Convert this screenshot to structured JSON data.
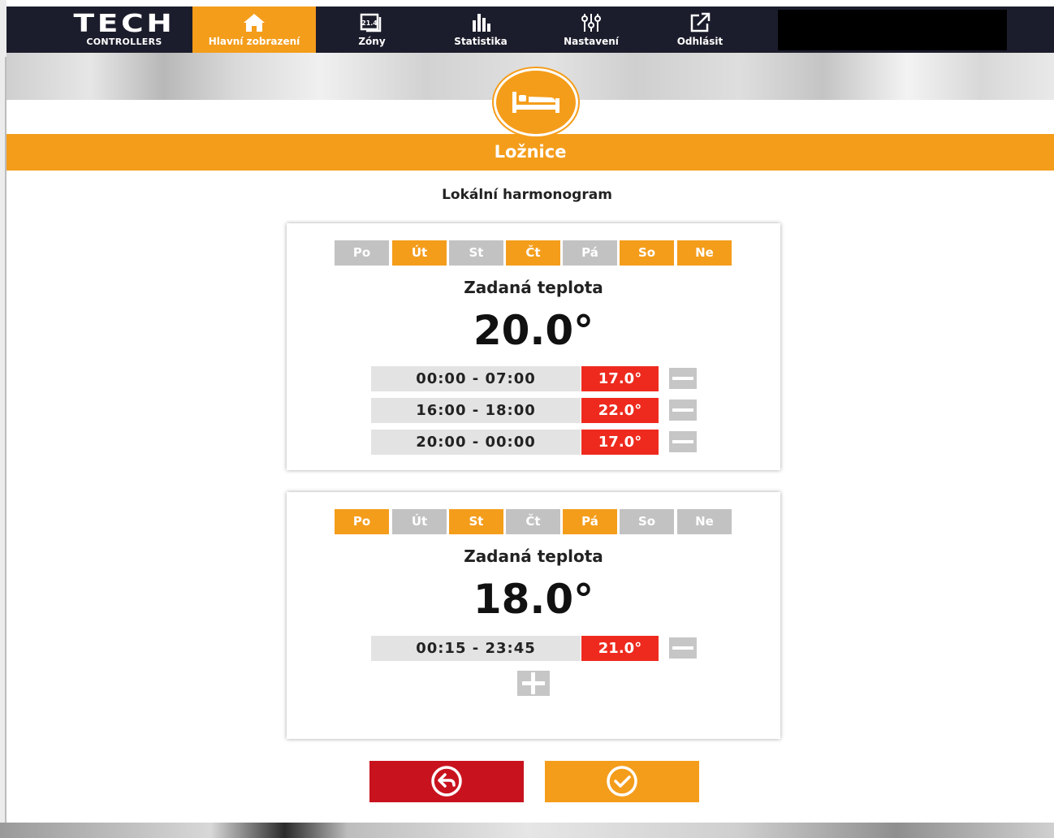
{
  "logo": {
    "brand": "TECH",
    "sub": "CONTROLLERS"
  },
  "nav": [
    {
      "label": "Hlavní zobrazení",
      "icon": "home-icon",
      "active": true
    },
    {
      "label": "Zóny",
      "icon": "zones-icon",
      "badge": "21.4",
      "active": false
    },
    {
      "label": "Statistika",
      "icon": "statistics-icon",
      "active": false
    },
    {
      "label": "Nastavení",
      "icon": "settings-sliders-icon",
      "active": false
    },
    {
      "label": "Odhlásit",
      "icon": "logout-icon",
      "active": false
    }
  ],
  "zone": {
    "name": "Ložnice",
    "icon": "bed-icon"
  },
  "schedule_title": "Lokální harmonogram",
  "cards": [
    {
      "days": [
        {
          "label": "Po",
          "active": false
        },
        {
          "label": "Út",
          "active": true
        },
        {
          "label": "St",
          "active": false
        },
        {
          "label": "Čt",
          "active": true
        },
        {
          "label": "Pá",
          "active": false
        },
        {
          "label": "So",
          "active": true
        },
        {
          "label": "Ne",
          "active": true
        }
      ],
      "setpoint_label": "Zadaná teplota",
      "setpoint": "20.0°",
      "intervals": [
        {
          "time": "00:00 - 07:00",
          "temp": "17.0°"
        },
        {
          "time": "16:00 - 18:00",
          "temp": "22.0°"
        },
        {
          "time": "20:00 - 00:00",
          "temp": "17.0°"
        }
      ]
    },
    {
      "days": [
        {
          "label": "Po",
          "active": true
        },
        {
          "label": "Út",
          "active": false
        },
        {
          "label": "St",
          "active": true
        },
        {
          "label": "Čt",
          "active": false
        },
        {
          "label": "Pá",
          "active": true
        },
        {
          "label": "So",
          "active": false
        },
        {
          "label": "Ne",
          "active": false
        }
      ],
      "setpoint_label": "Zadaná teplota",
      "setpoint": "18.0°",
      "intervals": [
        {
          "time": "00:15 - 23:45",
          "temp": "21.0°"
        }
      ]
    }
  ],
  "buttons": {
    "back_icon": "back-arrow-icon",
    "confirm_icon": "checkmark-icon"
  },
  "colors": {
    "accent": "#f49d1b",
    "nav_bg": "#1c1d2c",
    "temp_red": "#ee2a1e",
    "back_red": "#c8131f",
    "inactive_gray": "#c2c2c2"
  }
}
